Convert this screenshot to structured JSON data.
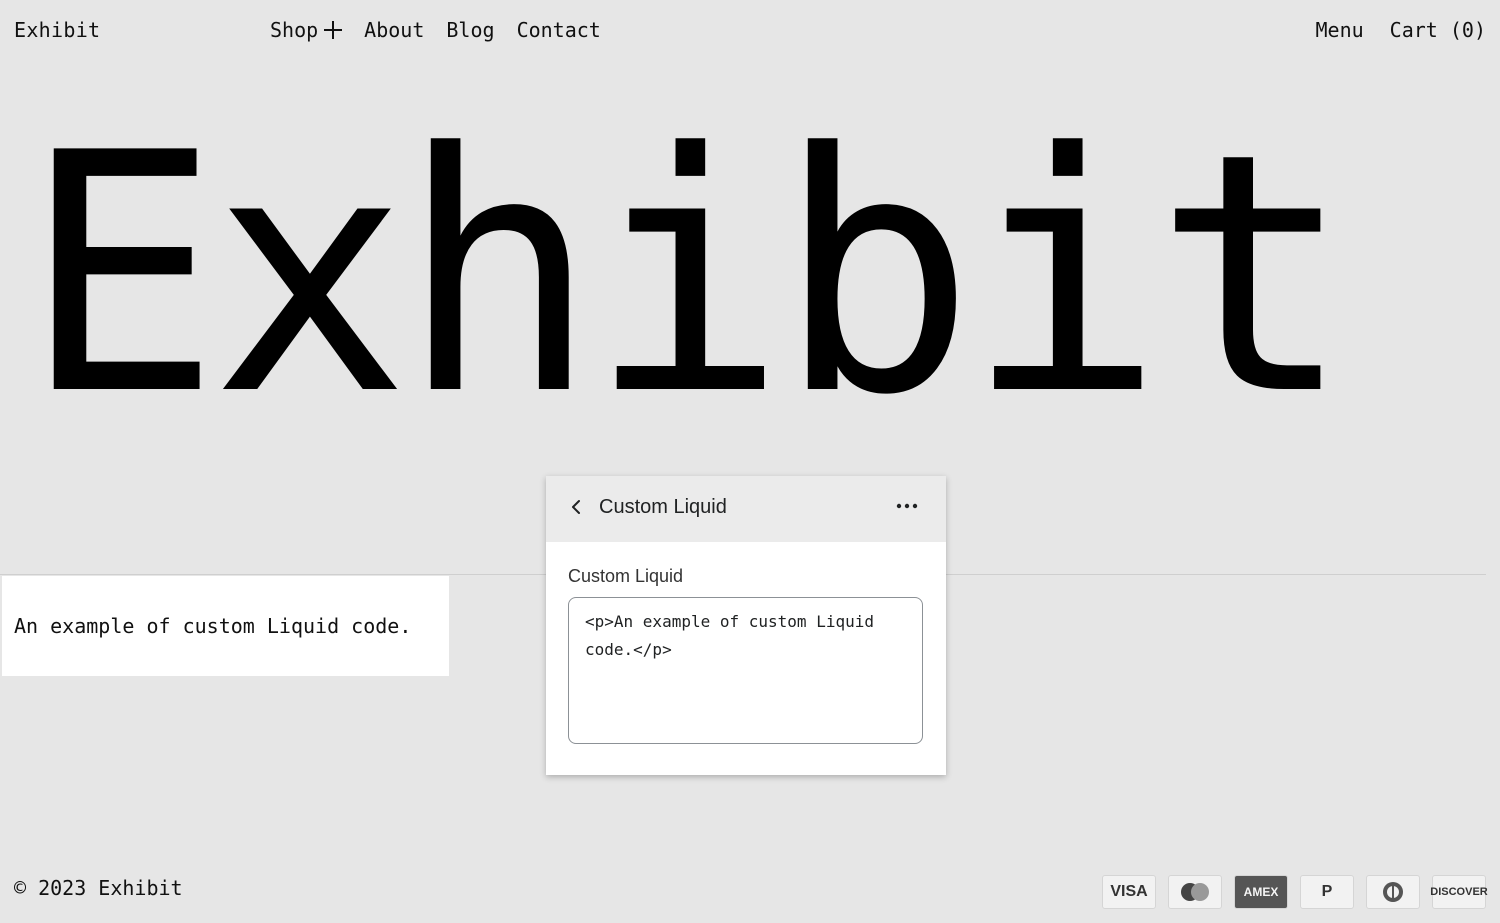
{
  "header": {
    "brand": "Exhibit",
    "nav": [
      {
        "label": "Shop"
      },
      {
        "label": "About"
      },
      {
        "label": "Blog"
      },
      {
        "label": "Contact"
      }
    ],
    "menu_label": "Menu",
    "cart_label": "Cart (0)"
  },
  "hero": {
    "title": "Exhibit"
  },
  "section": {
    "liquid_text": "An example of custom Liquid code."
  },
  "panel": {
    "title": "Custom Liquid",
    "field_label": "Custom Liquid",
    "code_value": "<p>An example of custom Liquid code.</p>"
  },
  "footer": {
    "copyright": "© 2023 Exhibit",
    "payments": [
      {
        "label": "VISA",
        "icon": "visa-icon"
      },
      {
        "label": "",
        "icon": "mastercard-icon"
      },
      {
        "label": "AMEX",
        "icon": "amex-icon"
      },
      {
        "label": "P",
        "icon": "paypal-icon"
      },
      {
        "label": "",
        "icon": "diners-icon"
      },
      {
        "label": "DISCOVER",
        "icon": "discover-icon"
      }
    ]
  }
}
